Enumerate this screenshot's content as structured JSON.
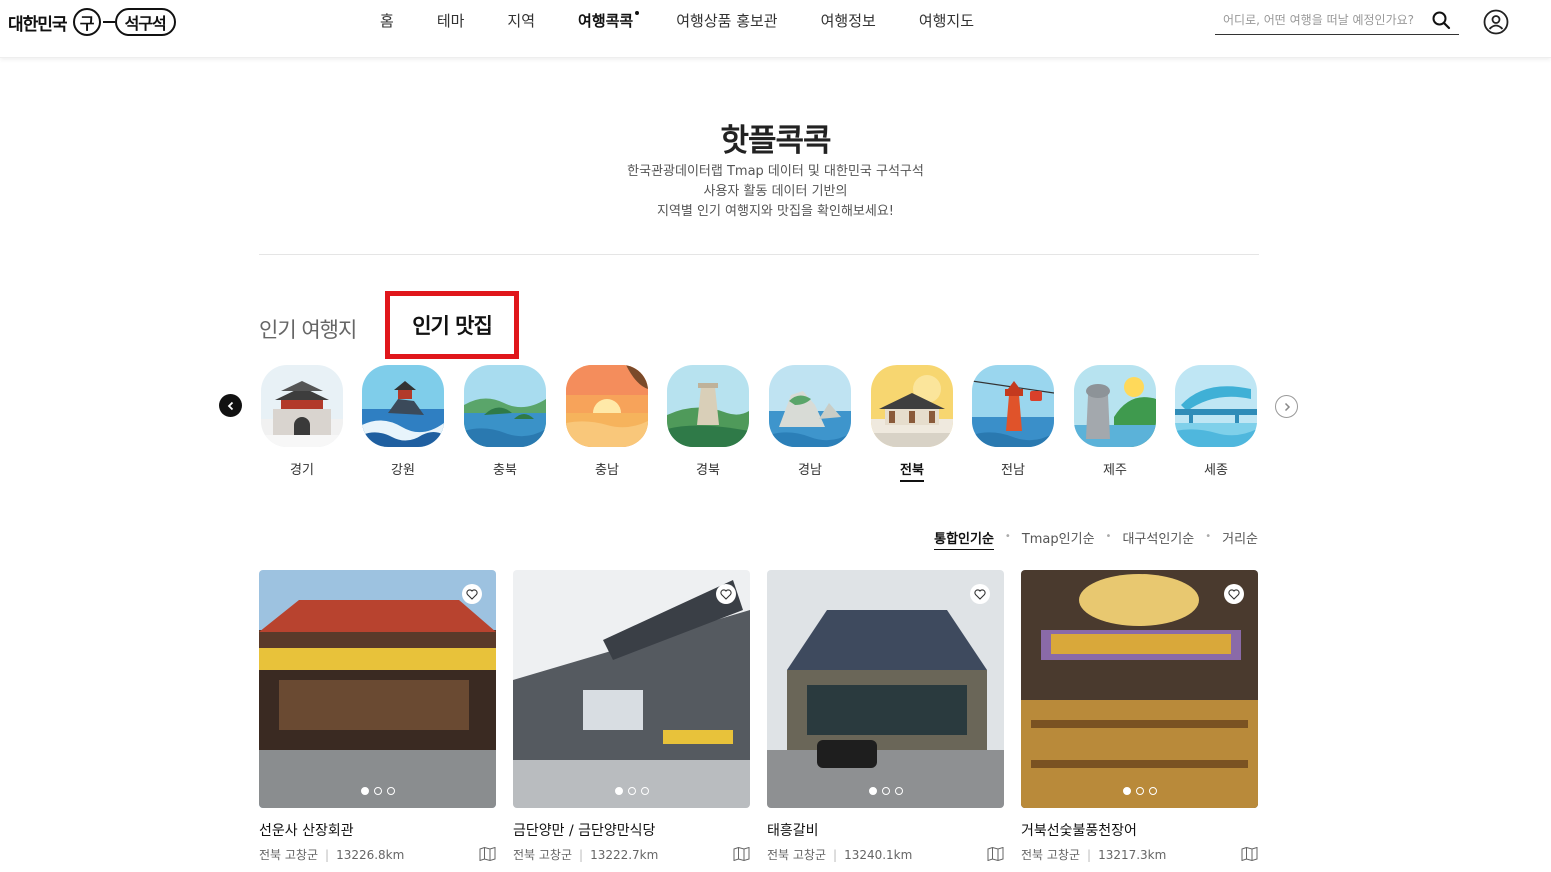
{
  "header": {
    "logo": {
      "part1": "대한민국",
      "part2": "구",
      "part3": "석구석"
    },
    "nav": [
      "홈",
      "테마",
      "지역",
      "여행콕콕",
      "여행상품 홍보관",
      "여행정보",
      "여행지도"
    ],
    "nav_active_index": 3,
    "search_placeholder": "어디로, 어떤 여행을 떠날 예정인가요?"
  },
  "page": {
    "title": "핫플콕콕",
    "desc_lines": [
      "한국관광데이터랩 Tmap 데이터 및 대한민국 구석구석",
      "사용자 활동 데이터 기반의",
      "지역별 인기 여행지와 맛집을 확인해보세요!"
    ]
  },
  "tabs": {
    "tab1": "인기 여행지",
    "tab2": "인기 맛집"
  },
  "regions": [
    {
      "label": "경기",
      "icon": "fortress-gate-icon"
    },
    {
      "label": "강원",
      "icon": "pavilion-rock-sea-icon"
    },
    {
      "label": "충북",
      "icon": "lake-island-icon"
    },
    {
      "label": "충남",
      "icon": "sunset-sea-icon"
    },
    {
      "label": "경북",
      "icon": "stone-tower-icon"
    },
    {
      "label": "경남",
      "icon": "coastal-rocks-icon"
    },
    {
      "label": "전북",
      "icon": "hanok-village-icon"
    },
    {
      "label": "전남",
      "icon": "lighthouse-cablecar-icon"
    },
    {
      "label": "제주",
      "icon": "dolhareubang-icon"
    },
    {
      "label": "세종",
      "icon": "bridge-lake-icon"
    }
  ],
  "region_active_index": 6,
  "sort": {
    "items": [
      "통합인기순",
      "Tmap인기순",
      "대구석인기순",
      "거리순"
    ],
    "active_index": 0,
    "separator": "•"
  },
  "cards": [
    {
      "name": "선운사 산장회관",
      "region": "전북 고창군",
      "distance": "13226.8km"
    },
    {
      "name": "금단양만 / 금단양만식당",
      "region": "전북 고창군",
      "distance": "13222.7km"
    },
    {
      "name": "태흥갈비",
      "region": "전북 고창군",
      "distance": "13240.1km"
    },
    {
      "name": "거북선숯불풍천장어",
      "region": "전북 고창군",
      "distance": "13217.3km"
    }
  ],
  "colors": {
    "highlight_red": "#e0161b"
  }
}
